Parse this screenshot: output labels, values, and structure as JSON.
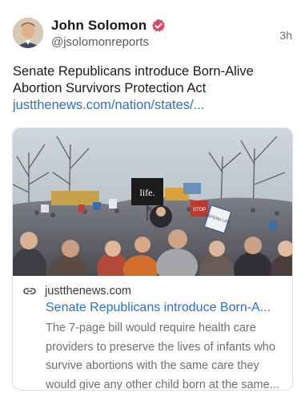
{
  "author": {
    "name": "John Solomon",
    "handle": "@jsolomonreports",
    "avatar_icon": "person-avatar",
    "verified_icon": "verified-badge-icon",
    "verified_color": "#e0465b"
  },
  "post": {
    "timestamp": "3h",
    "text_line1": "Senate Republicans introduce Born-Alive",
    "text_line2": "Abortion Survivors Protection Act",
    "link_text": "justthenews.com/nation/states/..."
  },
  "link_card": {
    "image_sign_text": "life.",
    "image_sign_stop": "STOP",
    "image_sign_defend": "DEFEND LIFE",
    "link_icon": "link-icon",
    "domain": "justthenews.com",
    "title": "Senate Republicans introduce Born-A...",
    "description_lines": [
      "The 7-page bill would require health care",
      "providers to preserve the lives of infants who",
      "survive abortions with the same care they",
      "would give any other child born at the same..."
    ]
  },
  "colors": {
    "link": "#2c6fd1",
    "text": "#1a1a1a",
    "muted": "#707070"
  }
}
